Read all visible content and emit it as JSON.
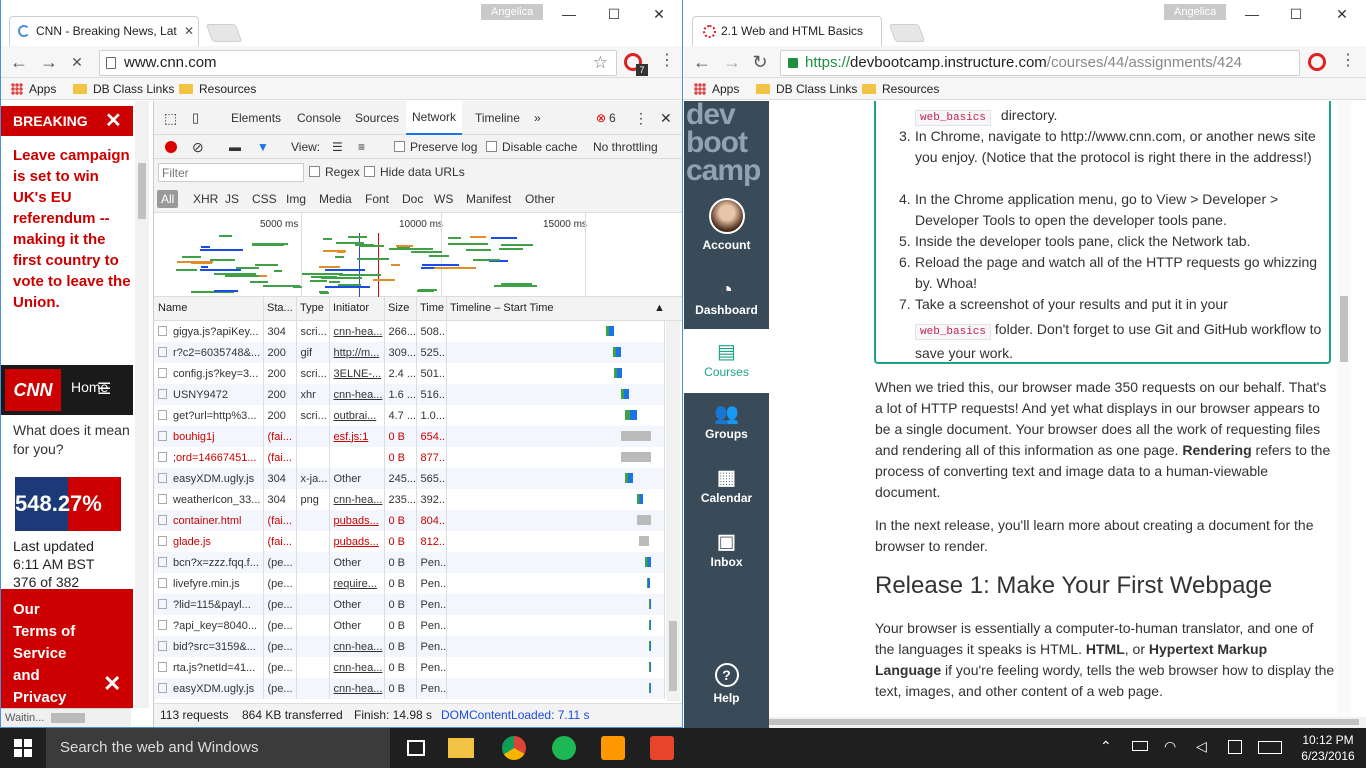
{
  "left_window": {
    "user": "Angelica",
    "tab_title": "CNN - Breaking News, Lat",
    "url": "www.cnn.com",
    "bookmarks": [
      "Apps",
      "DB Class Links",
      "Resources"
    ],
    "opera_badge": "7",
    "status": "Waitin..."
  },
  "cnn_page": {
    "breaking_label": "BREAKING",
    "breaking_text": "Leave campaign is set to win UK's EU referendum -- making it the first country to vote to leave the Union.",
    "logo": "CNN",
    "home": "Home",
    "question": "What does it mean for you?",
    "overlay_numbers": "548.27%",
    "updated_label": "Last updated",
    "updated_time": "6:11 AM BST",
    "count": "376 of 382",
    "terms": "Our Terms of Service and Privacy"
  },
  "devtools": {
    "tabs": [
      "Elements",
      "Console",
      "Sources",
      "Network",
      "Timeline"
    ],
    "active_tab": "Network",
    "error_count": "6",
    "view_label": "View:",
    "preserve_log": "Preserve log",
    "disable_cache": "Disable cache",
    "throttling": "No throttling",
    "filter_placeholder": "Filter",
    "regex": "Regex",
    "hide_data_urls": "Hide data URLs",
    "types": [
      "All",
      "XHR",
      "JS",
      "CSS",
      "Img",
      "Media",
      "Font",
      "Doc",
      "WS",
      "Manifest",
      "Other"
    ],
    "timeline_ticks": [
      "5000 ms",
      "10000 ms",
      "15000 ms"
    ],
    "columns": [
      "Name",
      "Sta...",
      "Type",
      "Initiator",
      "Size",
      "Time",
      "Timeline – Start Time"
    ],
    "rows": [
      {
        "name": "gigya.js?apiKey...",
        "status": "304",
        "type": "scri...",
        "initiator": "cnn-hea...",
        "size": "266...",
        "time": "508...",
        "fail": false
      },
      {
        "name": "r?c2=6035748&...",
        "status": "200",
        "type": "gif",
        "initiator": "http://m...",
        "size": "309...",
        "time": "525...",
        "fail": false
      },
      {
        "name": "config.js?key=3...",
        "status": "200",
        "type": "scri...",
        "initiator": "3ELNE-...",
        "size": "2.4 ...",
        "time": "501...",
        "fail": false
      },
      {
        "name": "USNY9472",
        "status": "200",
        "type": "xhr",
        "initiator": "cnn-hea...",
        "size": "1.6 ...",
        "time": "516...",
        "fail": false
      },
      {
        "name": "get?url=http%3...",
        "status": "200",
        "type": "scri...",
        "initiator": "outbrai...",
        "size": "4.7 ...",
        "time": "1.0...",
        "fail": false
      },
      {
        "name": "bouhig1j",
        "status": "(fai...",
        "type": "",
        "initiator": "esf.js:1",
        "size": "0 B",
        "time": "654...",
        "fail": true
      },
      {
        "name": ";ord=14667451...",
        "status": "(fai...",
        "type": "",
        "initiator": "",
        "size": "0 B",
        "time": "877...",
        "fail": true
      },
      {
        "name": "easyXDM.ugly.js",
        "status": "304",
        "type": "x-ja...",
        "initiator": "Other",
        "size": "245...",
        "time": "565...",
        "fail": false
      },
      {
        "name": "weatherIcon_33...",
        "status": "304",
        "type": "png",
        "initiator": "cnn-hea...",
        "size": "235...",
        "time": "392...",
        "fail": false
      },
      {
        "name": "container.html",
        "status": "(fai...",
        "type": "",
        "initiator": "pubads...",
        "size": "0 B",
        "time": "804...",
        "fail": true
      },
      {
        "name": "glade.js",
        "status": "(fai...",
        "type": "",
        "initiator": "pubads...",
        "size": "0 B",
        "time": "812...",
        "fail": true
      },
      {
        "name": "bcn?x=zzz.fqq.f...",
        "status": "(pe...",
        "type": "",
        "initiator": "Other",
        "size": "0 B",
        "time": "Pen...",
        "fail": false
      },
      {
        "name": "livefyre.min.js",
        "status": "(pe...",
        "type": "",
        "initiator": "require...",
        "size": "0 B",
        "time": "Pen...",
        "fail": false
      },
      {
        "name": "?lid=115&payl...",
        "status": "(pe...",
        "type": "",
        "initiator": "Other",
        "size": "0 B",
        "time": "Pen...",
        "fail": false
      },
      {
        "name": "?api_key=8040...",
        "status": "(pe...",
        "type": "",
        "initiator": "Other",
        "size": "0 B",
        "time": "Pen...",
        "fail": false
      },
      {
        "name": "bid?src=3159&...",
        "status": "(pe...",
        "type": "",
        "initiator": "cnn-hea...",
        "size": "0 B",
        "time": "Pen...",
        "fail": false
      },
      {
        "name": "rta.js?netId=41...",
        "status": "(pe...",
        "type": "",
        "initiator": "cnn-hea...",
        "size": "0 B",
        "time": "Pen...",
        "fail": false
      },
      {
        "name": "easyXDM.ugly.js",
        "status": "(pe...",
        "type": "",
        "initiator": "cnn-hea...",
        "size": "0 B",
        "time": "Pen...",
        "fail": false
      }
    ],
    "summary": {
      "requests": "113 requests",
      "transferred": "864 KB transferred",
      "finish": "Finish: 14.98 s",
      "dcl": "DOMContentLoaded: 7.11 s"
    }
  },
  "right_window": {
    "user": "Angelica",
    "tab_title": "2.1 Web and HTML Basics",
    "url_https": "https://",
    "url_host": "devbootcamp.instructure.com",
    "url_path": "/courses/44/assignments/424",
    "bookmarks": [
      "Apps",
      "DB Class Links",
      "Resources"
    ]
  },
  "canvas_nav": {
    "logo": [
      "dev",
      "boot",
      "camp"
    ],
    "items": [
      "Account",
      "Dashboard",
      "Courses",
      "Groups",
      "Calendar",
      "Inbox",
      "Help"
    ]
  },
  "lesson": {
    "code_web_basics": "web_basics",
    "step2_tail": "directory.",
    "steps": [
      {
        "num": "3.",
        "text": "In Chrome, navigate to http://www.cnn.com, or another news site you enjoy. (Notice that the protocol is right there in the address!)"
      },
      {
        "num": "4.",
        "text": "In the Chrome application menu, go to View > Developer > Developer Tools to open the developer tools pane."
      },
      {
        "num": "5.",
        "text": "Inside the developer tools pane, click the Network tab."
      },
      {
        "num": "6.",
        "text": "Reload the page and watch all of the HTTP requests go whizzing by. Whoa!"
      }
    ],
    "step7_num": "7.",
    "step7_a": "Take a screenshot of your results and put it in your",
    "step7_b": "folder. Don't forget to use Git and GitHub workflow to save your work.",
    "para1": "When we tried this, our browser made 350 requests on our behalf. That's a lot of HTTP requests! And yet what displays in our browser appears to be a single document. Your browser does all the work of requesting files and rendering all of this information as one page.",
    "para1_bold": "Rendering",
    "para1_tail": "refers to the process of converting text and image data to a human-viewable document.",
    "para2": "In the next release, you'll learn more about creating a document for the browser to render.",
    "heading": "Release 1: Make Your First Webpage",
    "para3_a": "Your browser is essentially a computer-to-human translator, and one of the languages it speaks is HTML.",
    "para3_html": "HTML",
    "para3_or": ", or",
    "para3_bold": "Hypertext Markup Language",
    "para3_b": "if you're feeling wordy, tells the web browser how to display the text, images, and other content of a web page."
  },
  "taskbar": {
    "search": "Search the web and Windows",
    "time": "10:12 PM",
    "date": "6/23/2016"
  },
  "colors": {
    "cnn_red": "#cc0000",
    "canvas_nav": "#394b58",
    "teal": "#1ea38b",
    "dt_blue": "#1a73e8"
  }
}
